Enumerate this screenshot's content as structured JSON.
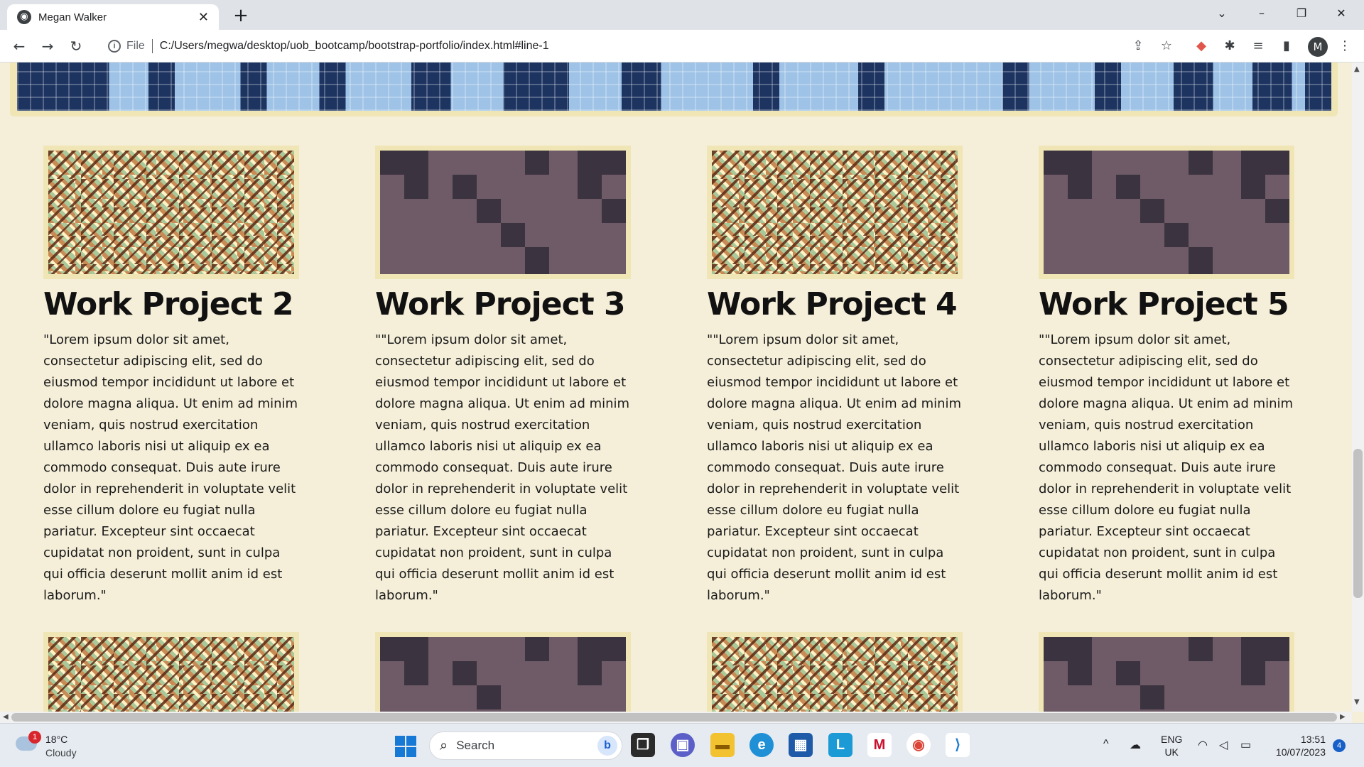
{
  "browser": {
    "tab_title": "Megan Walker",
    "tab_close": "✕",
    "new_tab": "+",
    "url_scheme_label": "File",
    "url": "C:/Users/megwa/desktop/uob_bootcamp/bootstrap-portfolio/index.html#line-1",
    "avatar_letter": "M"
  },
  "projects": [
    {
      "title": "Work Project 2",
      "body": "\"Lorem ipsum dolor sit amet, consectetur adipiscing elit, sed do eiusmod tempor incididunt ut labore et dolore magna aliqua. Ut enim ad minim veniam, quis nostrud exercitation ullamco laboris nisi ut aliquip ex ea commodo consequat. Duis aute irure dolor in reprehenderit in voluptate velit esse cillum dolore eu fugiat nulla pariatur. Excepteur sint occaecat cupidatat non proident, sunt in culpa qui officia deserunt mollit anim id est laborum.\""
    },
    {
      "title": "Work Project 3",
      "body": "\"\"Lorem ipsum dolor sit amet, consectetur adipiscing elit, sed do eiusmod tempor incididunt ut labore et dolore magna aliqua. Ut enim ad minim veniam, quis nostrud exercitation ullamco laboris nisi ut aliquip ex ea commodo consequat. Duis aute irure dolor in reprehenderit in voluptate velit esse cillum dolore eu fugiat nulla pariatur. Excepteur sint occaecat cupidatat non proident, sunt in culpa qui officia deserunt mollit anim id est laborum.\""
    },
    {
      "title": "Work Project 4",
      "body": "\"\"Lorem ipsum dolor sit amet, consectetur adipiscing elit, sed do eiusmod tempor incididunt ut labore et dolore magna aliqua. Ut enim ad minim veniam, quis nostrud exercitation ullamco laboris nisi ut aliquip ex ea commodo consequat. Duis aute irure dolor in reprehenderit in voluptate velit esse cillum dolore eu fugiat nulla pariatur. Excepteur sint occaecat cupidatat non proident, sunt in culpa qui officia deserunt mollit anim id est laborum.\""
    },
    {
      "title": "Work Project 5",
      "body": "\"\"Lorem ipsum dolor sit amet, consectetur adipiscing elit, sed do eiusmod tempor incididunt ut labore et dolore magna aliqua. Ut enim ad minim veniam, quis nostrud exercitation ullamco laboris nisi ut aliquip ex ea commodo consequat. Duis aute irure dolor in reprehenderit in voluptate velit esse cillum dolore eu fugiat nulla pariatur. Excepteur sint occaecat cupidatat non proident, sunt in culpa qui officia deserunt mollit anim id est laborum.\""
    }
  ],
  "taskbar": {
    "weather_temp": "18°C",
    "weather_cond": "Cloudy",
    "weather_badge": "1",
    "search_placeholder": "Search",
    "lang_line1": "ENG",
    "lang_line2": "UK",
    "time": "13:51",
    "date": "10/07/2023",
    "notification_count": "4"
  },
  "colors": {
    "page_bg": "#f5efd9",
    "thumb_frame": "#efe5b5",
    "hero_dark": "#1d3461",
    "hero_light": "#9fc3e7"
  }
}
